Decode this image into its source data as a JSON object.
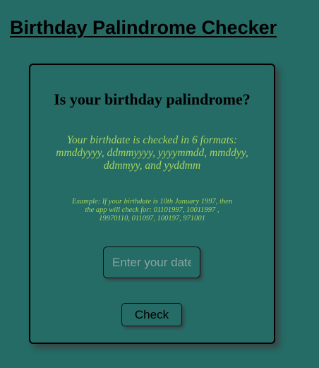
{
  "app": {
    "title": "Birthday Palindrome Checker"
  },
  "card": {
    "heading": "Is your birthday palindrome?",
    "formats_text": "Your birthdate is checked in 6 formats: mmddyyyy, ddmmyyyy, yyyymmdd, mmddyy, ddmmyy, and yyddmm",
    "example_text": "Example: If your birthdate is 10th January 1997, then the app will check for: 01101997, 10011997 , 19970110, 011097, 100197, 971001",
    "date_input": {
      "placeholder": "Enter your date",
      "value": ""
    },
    "check_button_label": "Check"
  },
  "colors": {
    "background": "#256b66",
    "accent_text": "#a8d65c",
    "border": "#000000"
  }
}
